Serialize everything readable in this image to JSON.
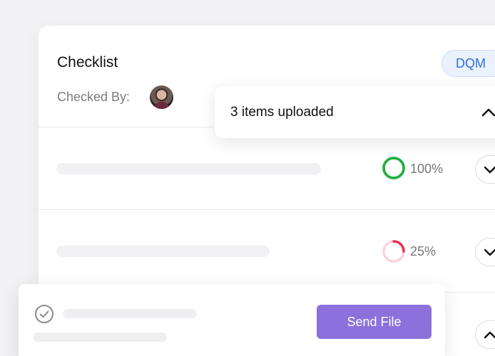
{
  "checklist": {
    "title": "Checklist",
    "badge": "DQM",
    "checked_by_label": "Checked By:"
  },
  "popover": {
    "text": "3 items uploaded"
  },
  "items": [
    {
      "percent_label": "100%",
      "progress": 1.0,
      "color": "#1fae3c"
    },
    {
      "percent_label": "25%",
      "progress": 0.25,
      "color": "#e8334f"
    }
  ],
  "bottom": {
    "send_label": "Send File"
  },
  "colors": {
    "accent": "#8c70dc",
    "badge": "#2f6fe0",
    "success": "#1fae3c",
    "danger": "#e8334f"
  }
}
